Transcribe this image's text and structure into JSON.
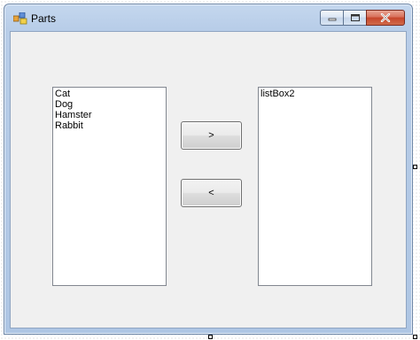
{
  "window": {
    "title": "Parts",
    "icon": "form-icon"
  },
  "caption_buttons": {
    "minimize": "minimize-icon",
    "maximize": "maximize-icon",
    "close": "close-icon"
  },
  "list_left": {
    "items": [
      "Cat",
      "Dog",
      "Hamster",
      "Rabbit"
    ]
  },
  "list_right": {
    "items": [
      "listBox2"
    ]
  },
  "buttons": {
    "move_right_label": ">",
    "move_left_label": "<"
  },
  "colors": {
    "close_red": "#c6452b",
    "client_bg": "#f0f0f0"
  }
}
